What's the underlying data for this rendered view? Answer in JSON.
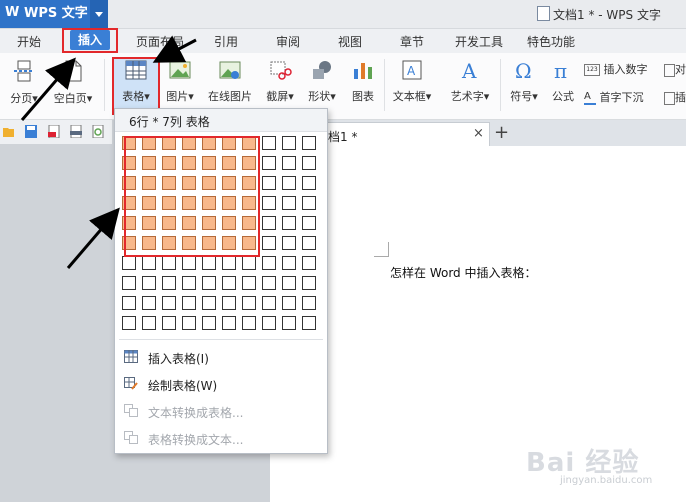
{
  "app": {
    "name": "WPS 文字",
    "logo": "W",
    "document_title": "文档1 * - WPS 文字"
  },
  "menu_tabs": [
    "开始",
    "插入",
    "页面布局",
    "引用",
    "审阅",
    "视图",
    "章节",
    "开发工具",
    "特色功能"
  ],
  "active_tab": "插入",
  "ribbon": {
    "page_break": "分页",
    "blank_page": "空白页",
    "table": "表格",
    "picture": "图片",
    "online_picture": "在线图片",
    "screenshot": "截屏",
    "shapes": "形状",
    "chart": "图表",
    "textbox": "文本框",
    "wordart": "艺术字",
    "symbol": "符号",
    "formula": "公式",
    "insert_number": "插入数字",
    "drop_cap": "首字下沉",
    "object_partial": "对",
    "insert_partial": "插"
  },
  "doc_tab": {
    "label": "档1 *"
  },
  "table_picker": {
    "header": "6行 * 7列 表格",
    "rows": 10,
    "cols": 10,
    "selected_rows": 6,
    "selected_cols": 7,
    "items": [
      {
        "label": "插入表格(I)",
        "enabled": true,
        "icon": "table-icon"
      },
      {
        "label": "绘制表格(W)",
        "enabled": true,
        "icon": "draw-table-icon"
      },
      {
        "label": "文本转换成表格...",
        "enabled": false,
        "icon": "text-to-table-icon"
      },
      {
        "label": "表格转换成文本...",
        "enabled": false,
        "icon": "table-to-text-icon"
      }
    ]
  },
  "document": {
    "text": "怎样在 Word 中插入表格："
  },
  "watermark": {
    "main": "Bai 经验",
    "sub": "jingyan.baidu.com"
  },
  "colors": {
    "accent": "#2f73c8",
    "highlight": "#e2282b",
    "selected_cell": "#f8b88b"
  }
}
